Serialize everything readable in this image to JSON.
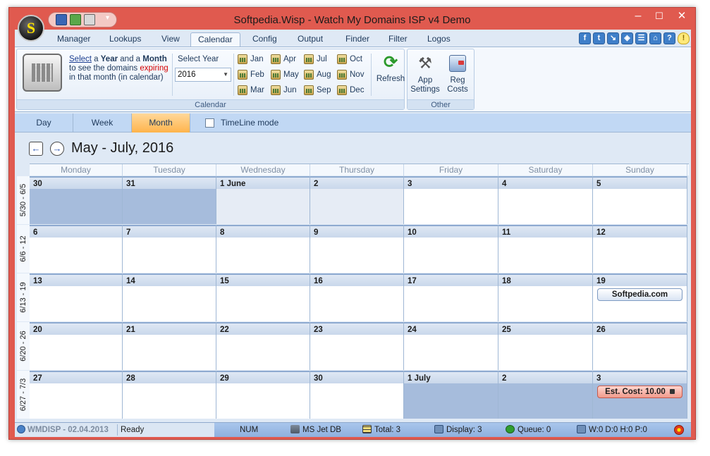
{
  "window": {
    "title": "Softpedia.Wisp - Watch My Domains ISP v4 Demo",
    "orb_letter": "S",
    "controls": {
      "minimize": "–",
      "maximize": "☐",
      "close": "✕"
    }
  },
  "quick_access": {
    "more": "▾"
  },
  "tabs": [
    "Manager",
    "Lookups",
    "View",
    "Calendar",
    "Config",
    "Output",
    "Finder",
    "Filter",
    "Logos"
  ],
  "active_tab": "Calendar",
  "top_icons": [
    "f",
    "t",
    "↘",
    "◈",
    "☰",
    "⌂",
    "?",
    "💡"
  ],
  "ribbon": {
    "calendar_group": {
      "label": "Calendar",
      "desc_select": "Select",
      "desc_a": " a ",
      "desc_year": "Year",
      "desc_and": " and a ",
      "desc_month": "Month",
      "desc_to": " to see the domains ",
      "desc_expiring": "expiring",
      "desc_rest": " in that month (in calendar)",
      "select_year_label": "Select Year",
      "year_value": "2016",
      "months": [
        "Jan",
        "Feb",
        "Mar",
        "Apr",
        "May",
        "Jun",
        "Jul",
        "Aug",
        "Sep",
        "Oct",
        "Nov",
        "Dec"
      ],
      "refresh_label": "Refresh"
    },
    "other_group": {
      "label": "Other",
      "app_settings_1": "App",
      "app_settings_2": "Settings",
      "reg_costs_1": "Reg",
      "reg_costs_2": "Costs"
    }
  },
  "viewbar": {
    "views": [
      "Day",
      "Week",
      "Month"
    ],
    "active_view": "Month",
    "timeline_label": "TimeLine mode"
  },
  "calendar": {
    "range_title": "May - July, 2016",
    "weekdays": [
      "Monday",
      "Tuesday",
      "Wednesday",
      "Thursday",
      "Friday",
      "Saturday",
      "Sunday"
    ],
    "weeks": [
      {
        "label": "5/30 - 6/5",
        "days": [
          {
            "num": "30",
            "shade": "past"
          },
          {
            "num": "31",
            "shade": "past"
          },
          {
            "num": "1 June",
            "shade": "light"
          },
          {
            "num": "2",
            "shade": "light"
          },
          {
            "num": "3"
          },
          {
            "num": "4"
          },
          {
            "num": "5"
          }
        ]
      },
      {
        "label": "6/6 - 12",
        "days": [
          {
            "num": "6"
          },
          {
            "num": "7"
          },
          {
            "num": "8"
          },
          {
            "num": "9"
          },
          {
            "num": "10"
          },
          {
            "num": "11"
          },
          {
            "num": "12"
          }
        ]
      },
      {
        "label": "6/13 - 19",
        "days": [
          {
            "num": "13"
          },
          {
            "num": "14"
          },
          {
            "num": "15"
          },
          {
            "num": "16"
          },
          {
            "num": "17"
          },
          {
            "num": "18"
          },
          {
            "num": "19",
            "event": "Softpedia.com"
          }
        ]
      },
      {
        "label": "6/20 - 26",
        "days": [
          {
            "num": "20"
          },
          {
            "num": "21"
          },
          {
            "num": "22"
          },
          {
            "num": "23"
          },
          {
            "num": "24"
          },
          {
            "num": "25"
          },
          {
            "num": "26"
          }
        ]
      },
      {
        "label": "6/27 - 7/3",
        "days": [
          {
            "num": "27"
          },
          {
            "num": "28"
          },
          {
            "num": "29"
          },
          {
            "num": "30"
          },
          {
            "num": "1 July",
            "shade": "past"
          },
          {
            "num": "2",
            "shade": "past"
          },
          {
            "num": "3",
            "shade": "past",
            "event": "Est. Cost: 10.00",
            "event_style": "cost"
          }
        ]
      }
    ]
  },
  "statusbar": {
    "version": "WMDISP - 02.04.2013",
    "ready": "Ready",
    "num": "NUM",
    "db": "MS Jet DB",
    "total": "Total: 3",
    "display": "Display: 3",
    "queue": "Queue: 0",
    "net": "W:0 D:0 H:0 P:0"
  }
}
